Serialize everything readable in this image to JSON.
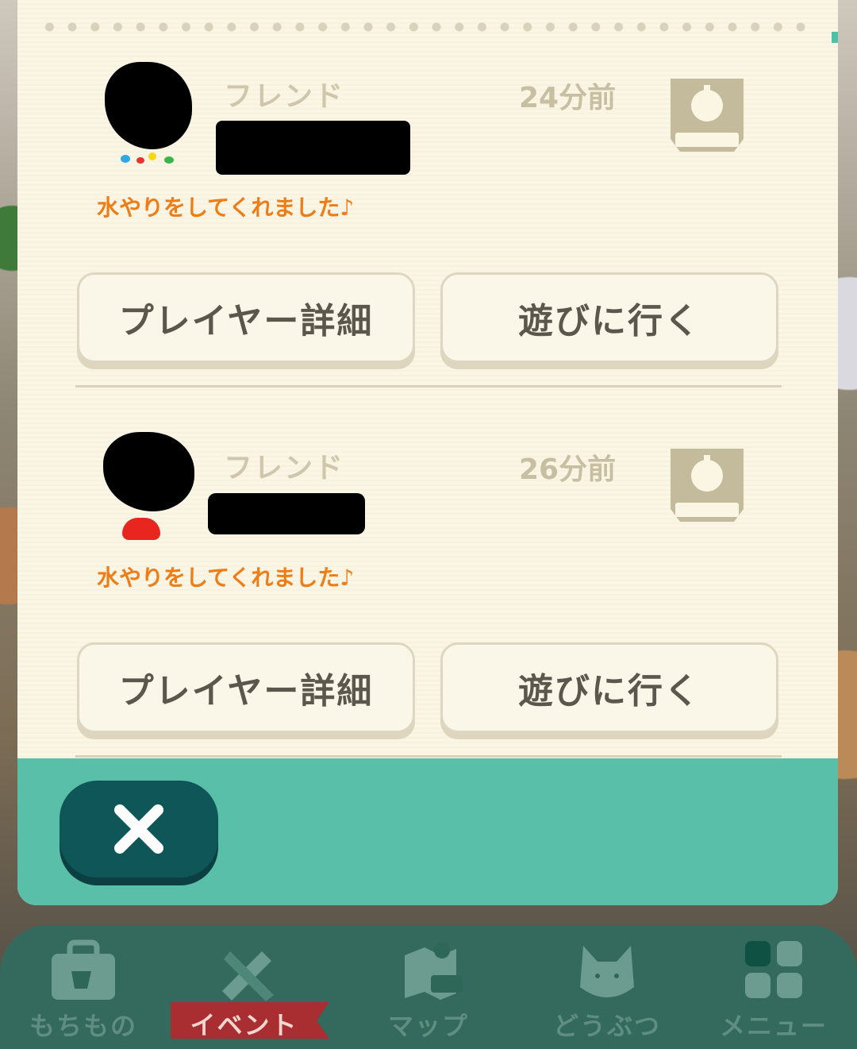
{
  "entries": [
    {
      "relation": "フレンド",
      "time": "24分前",
      "message": "水やりをしてくれました♪",
      "details_button": "プレイヤー詳細",
      "visit_button": "遊びに行く"
    },
    {
      "relation": "フレンド",
      "time": "26分前",
      "message": "水やりをしてくれました♪",
      "details_button": "プレイヤー詳細",
      "visit_button": "遊びに行く"
    }
  ],
  "nav": {
    "items": [
      {
        "label": "もちもの",
        "icon": "bag-icon"
      },
      {
        "label": "イベント",
        "icon": "tools-icon"
      },
      {
        "label": "マップ",
        "icon": "map-icon"
      },
      {
        "label": "どうぶつ",
        "icon": "cat-icon"
      },
      {
        "label": "メニュー",
        "icon": "grid-menu-icon"
      }
    ]
  },
  "colors": {
    "panel": "#fbf6e4",
    "accent": "#59bfa8",
    "message": "#ee7d17",
    "navbar": "#336a5d"
  }
}
